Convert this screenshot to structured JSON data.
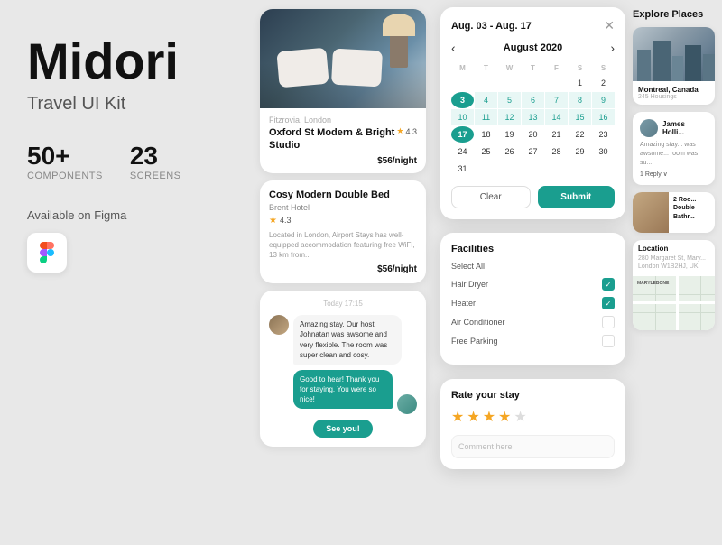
{
  "brand": {
    "title": "Midori",
    "subtitle": "Travel UI Kit",
    "stats": [
      {
        "number": "50+",
        "label": "COMPONENTS"
      },
      {
        "number": "23",
        "label": "SCREENS"
      }
    ],
    "available_text": "Available on Figma"
  },
  "hotel_card_1": {
    "location": "Fitzrovia, London",
    "name": "Oxford St Modern & Bright Studio",
    "rating": "4.3",
    "price": "$56/night"
  },
  "hotel_card_2": {
    "name": "Cosy Modern Double Bed",
    "sub": "Brent Hotel",
    "rating_num": "4.3",
    "description": "Located in London, Airport Stays has well-equipped accommodation featuring free WiFi, 13 km from...",
    "price": "$56/night"
  },
  "chat": {
    "time": "Today 17:15",
    "msg_left": "Amazing stay. Our host, Johnatan was awsome and very flexible. The room was super clean and cosy.",
    "msg_right": "Good to hear! Thank you for staying. You were so nice!",
    "cta": "See you!"
  },
  "calendar": {
    "date_range": "Aug. 03 - Aug. 17",
    "month": "August 2020",
    "days_headers": [
      "M",
      "T",
      "W",
      "T",
      "F",
      "S",
      "S"
    ],
    "days": [
      {
        "day": "",
        "type": "empty"
      },
      {
        "day": "",
        "type": "empty"
      },
      {
        "day": "",
        "type": "empty"
      },
      {
        "day": "",
        "type": "empty"
      },
      {
        "day": "",
        "type": "empty"
      },
      {
        "day": "1",
        "type": "normal"
      },
      {
        "day": "2",
        "type": "normal"
      },
      {
        "day": "3",
        "type": "selected-start"
      },
      {
        "day": "4",
        "type": "in-range"
      },
      {
        "day": "5",
        "type": "in-range"
      },
      {
        "day": "6",
        "type": "in-range"
      },
      {
        "day": "7",
        "type": "in-range"
      },
      {
        "day": "8",
        "type": "in-range"
      },
      {
        "day": "9",
        "type": "in-range"
      },
      {
        "day": "10",
        "type": "in-range"
      },
      {
        "day": "11",
        "type": "in-range"
      },
      {
        "day": "12",
        "type": "in-range"
      },
      {
        "day": "13",
        "type": "in-range"
      },
      {
        "day": "14",
        "type": "in-range"
      },
      {
        "day": "15",
        "type": "in-range"
      },
      {
        "day": "16",
        "type": "in-range"
      },
      {
        "day": "17",
        "type": "selected-end"
      },
      {
        "day": "18",
        "type": "normal"
      },
      {
        "day": "19",
        "type": "normal"
      },
      {
        "day": "20",
        "type": "normal"
      },
      {
        "day": "21",
        "type": "normal"
      },
      {
        "day": "22",
        "type": "normal"
      },
      {
        "day": "23",
        "type": "normal"
      },
      {
        "day": "24",
        "type": "normal"
      },
      {
        "day": "25",
        "type": "normal"
      },
      {
        "day": "26",
        "type": "normal"
      },
      {
        "day": "27",
        "type": "normal"
      },
      {
        "day": "28",
        "type": "normal"
      },
      {
        "day": "29",
        "type": "normal"
      },
      {
        "day": "30",
        "type": "normal"
      },
      {
        "day": "31",
        "type": "normal"
      }
    ],
    "btn_clear": "Clear",
    "btn_submit": "Submit"
  },
  "facilities": {
    "title": "Facilities",
    "select_all": "Select All",
    "items": [
      {
        "label": "Hair Dryer",
        "checked": true
      },
      {
        "label": "Heater",
        "checked": true
      },
      {
        "label": "Air Conditioner",
        "checked": false
      },
      {
        "label": "Free Parking",
        "checked": false
      }
    ]
  },
  "rate": {
    "title": "Rate your stay",
    "stars": [
      true,
      true,
      true,
      true,
      false
    ],
    "placeholder": "Comment here"
  },
  "right_panel": {
    "explore_title": "Explore Places",
    "places": [
      {
        "name": "Montreal, Canada",
        "count": "245 Housings",
        "type": "city"
      },
      {
        "name": "2 Roo... Double Bathr...",
        "count": "",
        "type": "room"
      }
    ],
    "review": {
      "reviewer": "James Holli...",
      "text": "Amazing stay... was awsome... room was su...",
      "reply": "1 Reply ∨"
    },
    "location": {
      "title": "Location",
      "address": "280 Margaret St, Mary...\nLondon W1B2HJ, UK"
    }
  }
}
